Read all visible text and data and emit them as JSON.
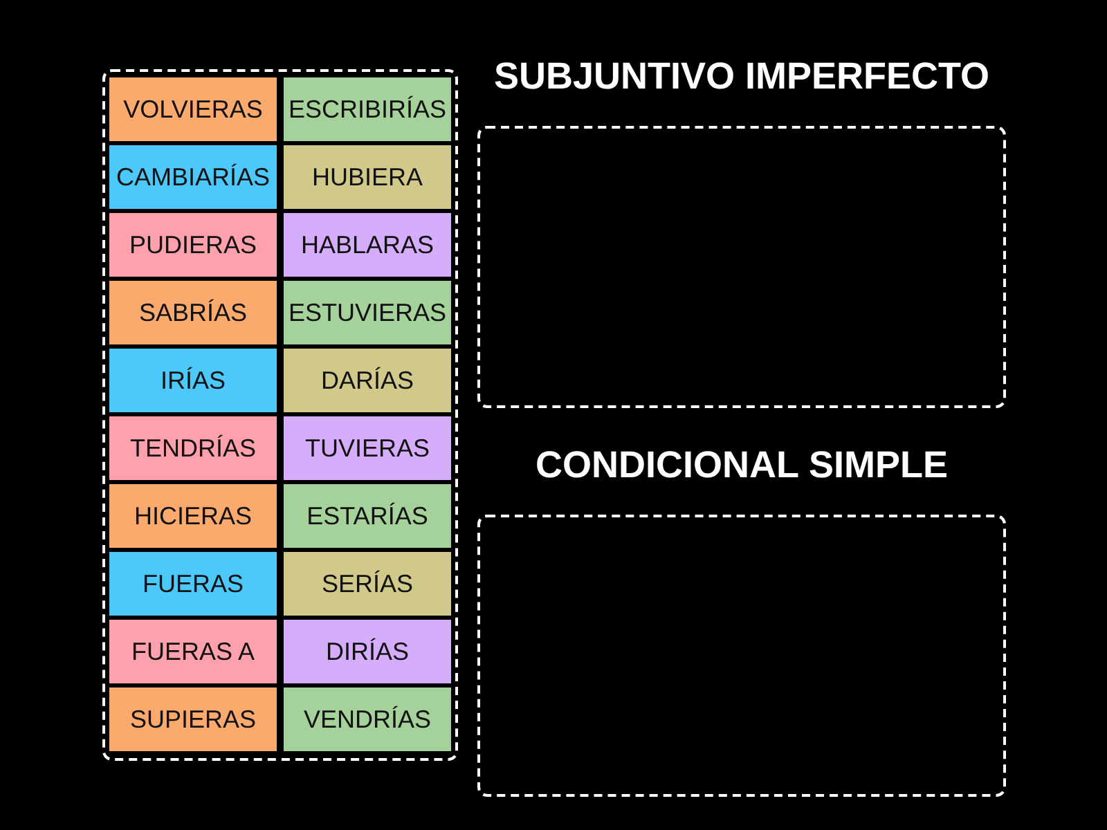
{
  "word_bank": {
    "tiles": [
      {
        "text": "VOLVIERAS",
        "color": "#fbaa6d"
      },
      {
        "text": "ESCRIBIRÍAS",
        "color": "#a4d29a"
      },
      {
        "text": "CAMBIARÍAS",
        "color": "#4dc8fb"
      },
      {
        "text": "HUBIERA",
        "color": "#d1c98a"
      },
      {
        "text": "PUDIERAS",
        "color": "#ffa0ad"
      },
      {
        "text": "HABLARAS",
        "color": "#d6acfc"
      },
      {
        "text": "SABRÍAS",
        "color": "#fbaa6d"
      },
      {
        "text": "ESTUVIERAS",
        "color": "#a4d29a"
      },
      {
        "text": "IRÍAS",
        "color": "#4dc8fb"
      },
      {
        "text": "DARÍAS",
        "color": "#d1c98a"
      },
      {
        "text": "TENDRÍAS",
        "color": "#ffa0ad"
      },
      {
        "text": "TUVIERAS",
        "color": "#d6acfc"
      },
      {
        "text": "HICIERAS",
        "color": "#fbaa6d"
      },
      {
        "text": "ESTARÍAS",
        "color": "#a4d29a"
      },
      {
        "text": "FUERAS",
        "color": "#4dc8fb"
      },
      {
        "text": "SERÍAS",
        "color": "#d1c98a"
      },
      {
        "text": "FUERAS A",
        "color": "#ffa0ad"
      },
      {
        "text": "DIRÍAS",
        "color": "#d6acfc"
      },
      {
        "text": "SUPIERAS",
        "color": "#fbaa6d"
      },
      {
        "text": "VENDRÍAS",
        "color": "#a4d29a"
      }
    ]
  },
  "groups": [
    {
      "title": "SUBJUNTIVO IMPERFECTO"
    },
    {
      "title": "CONDICIONAL SIMPLE"
    }
  ]
}
